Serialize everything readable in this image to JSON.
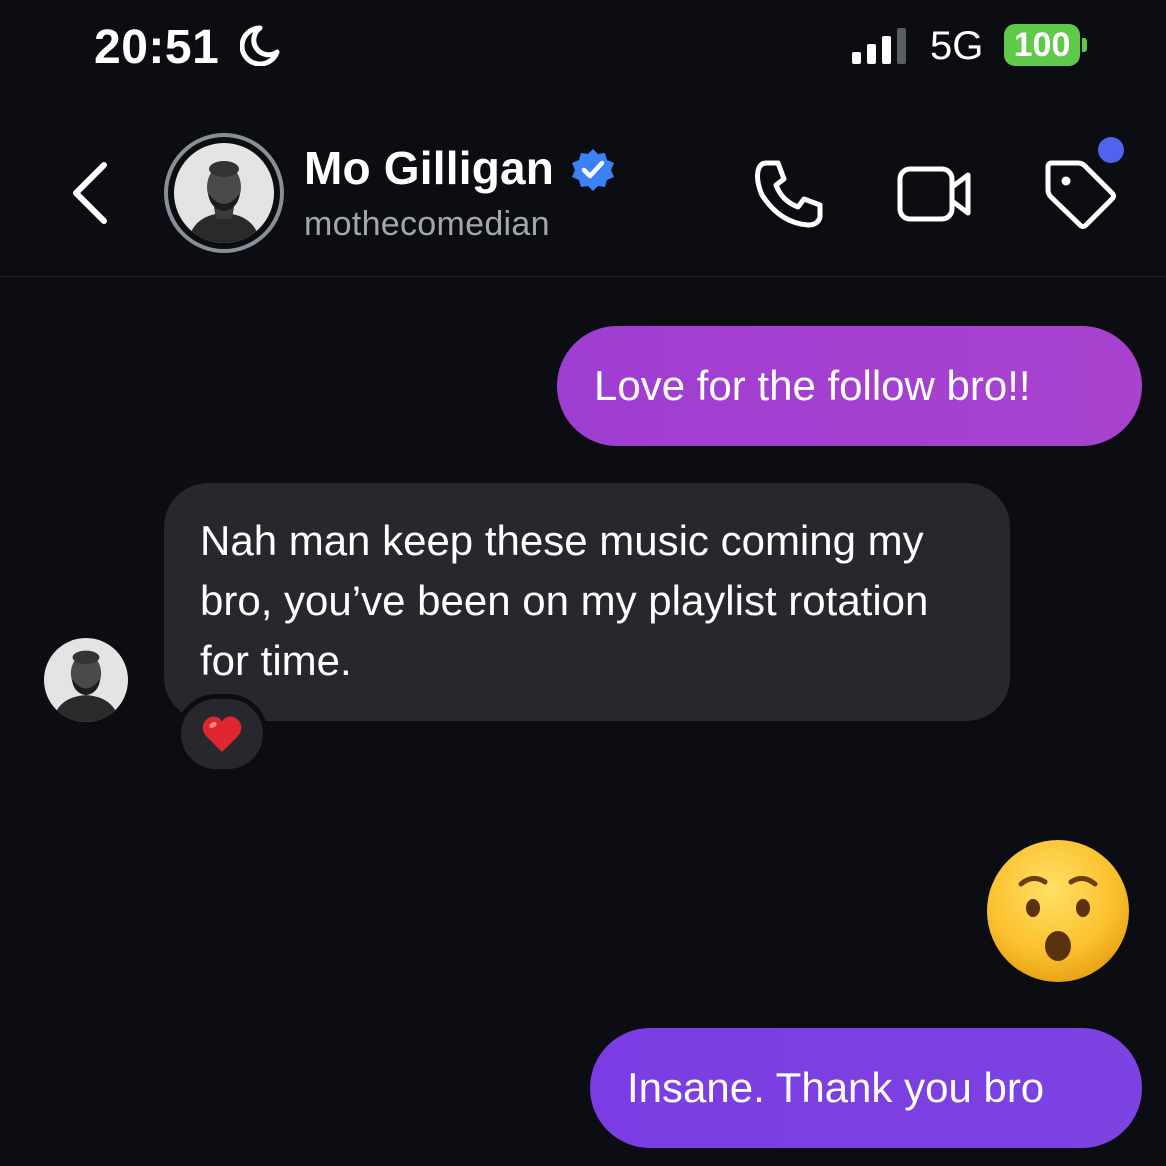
{
  "status_bar": {
    "time": "20:51",
    "network": "5G",
    "battery": "100",
    "icons": [
      "moon-icon",
      "signal-icon"
    ]
  },
  "header": {
    "name": "Mo Gilligan",
    "username": "mothecomedian",
    "verified": true,
    "icons": [
      "back-icon",
      "phone-icon",
      "video-icon",
      "tag-icon"
    ],
    "notification_dot_color": "#4f63ee"
  },
  "messages": [
    {
      "direction": "sent",
      "text": "Love for the follow bro!!"
    },
    {
      "direction": "received",
      "text": "Nah man keep these music coming my bro, you’ve been on my playlist rotation for time.",
      "reaction": "heart"
    },
    {
      "direction": "sent",
      "sticker": "hushed-face-emoji"
    },
    {
      "direction": "sent",
      "text": "Insane. Thank you bro"
    }
  ],
  "colors": {
    "background": "#0b0d12",
    "sent_bubble_1": "#a842cf",
    "sent_bubble_2": "#7d42e2",
    "received_bubble": "#26282e",
    "battery": "#5fc94a",
    "verified": "#3b82f6"
  }
}
